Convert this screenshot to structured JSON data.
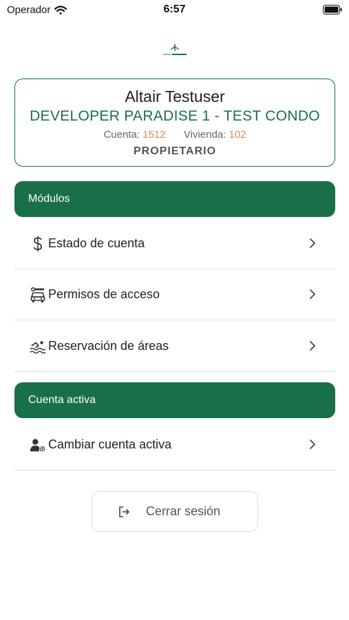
{
  "status_bar": {
    "carrier": "Operador",
    "time": "6:57",
    "icons": [
      "wifi-icon",
      "battery-icon"
    ]
  },
  "logo": {
    "name": "AdCon Rivera logo",
    "colors": {
      "primary": "#1a7046",
      "secondary": "#8fc29f"
    }
  },
  "profile": {
    "user_name": "Altair Testuser",
    "condo_name": "DEVELOPER PARADISE 1 - TEST CONDO",
    "account_label": "Cuenta:",
    "account_number": "1512",
    "home_label": "Vivienda:",
    "home_number": "102",
    "role": "PROPIETARIO"
  },
  "sections": {
    "modules_title": "Módulos",
    "active_account_title": "Cuenta activa"
  },
  "menu": {
    "estado": {
      "label": "Estado de cuenta",
      "icon": "dollar-icon"
    },
    "permisos": {
      "label": "Permisos de acceso",
      "icon": "gate-car-icon"
    },
    "reservacion": {
      "label": "Reservación de áreas",
      "icon": "swimming-icon"
    },
    "cambiar": {
      "label": "Cambiar cuenta activa",
      "icon": "user-gear-icon"
    }
  },
  "logout": {
    "label": "Cerrar sesión",
    "icon": "logout-icon"
  },
  "colors": {
    "brand_green": "#1a7046",
    "number_orange": "#e0875e",
    "divider": "#e2e2e2"
  }
}
